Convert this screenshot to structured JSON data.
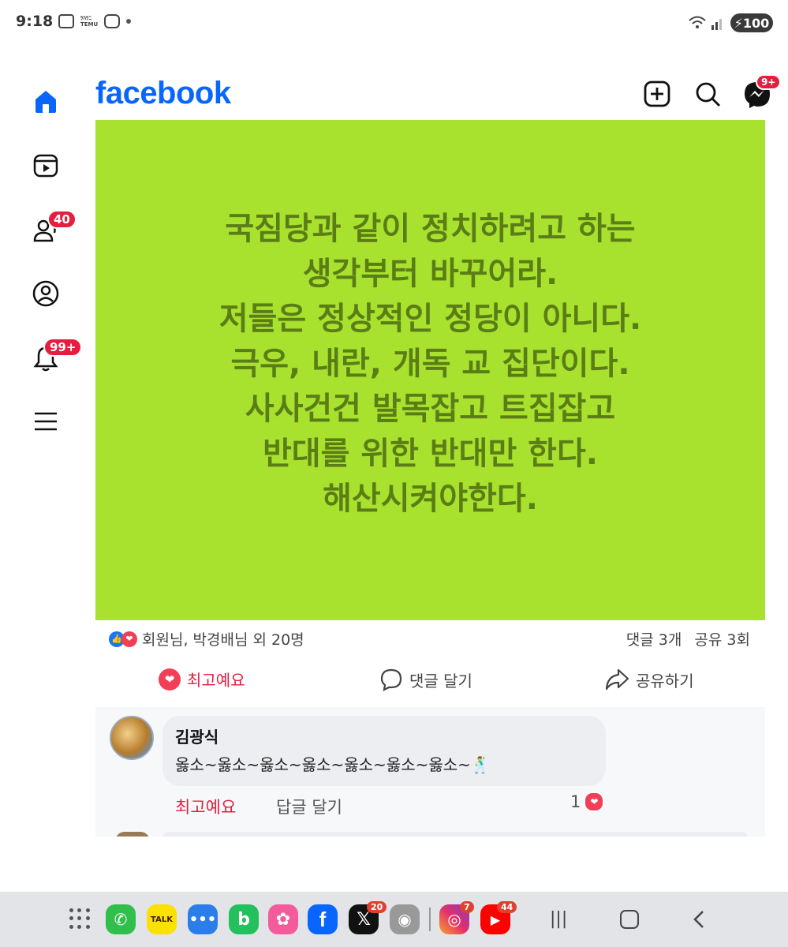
{
  "status_bar": {
    "time": "9:18",
    "temu": "TEMU",
    "battery": "100"
  },
  "left_nav": {
    "friends_badge": "40",
    "notifications_badge": "99+"
  },
  "header": {
    "logo": "facebook",
    "messenger_badge": "9+"
  },
  "post": {
    "image_text": "국짐당과 같이 정치하려고 하는\n생각부터 바꾸어라.\n저들은 정상적인 정당이 아니다.\n극우, 내란, 개독 교 집단이다.\n사사건건 발목잡고 트집잡고\n반대를 위한 반대만 한다.\n해산시켜야한다.",
    "reactions_text": "회원님, 박경배님 외 20명",
    "comments_count": "댓글 3개",
    "shares_count": "공유 3회",
    "like_label": "최고예요",
    "comment_label": "댓글 달기",
    "share_label": "공유하기"
  },
  "comment": {
    "author": "김광식",
    "text": "옳소~옳소~옳소~옳소~옳소~옳소~옳소~🕺",
    "like_label": "최고예요",
    "reply_label": "답글 달기",
    "reaction_count": "1"
  },
  "dock": {
    "kakao_label": "TALK",
    "x_badge": "20",
    "instagram_badge": "7",
    "youtube_badge": "44"
  },
  "colors": {
    "facebook_blue": "#0866ff",
    "post_bg": "#a8e22e",
    "post_text": "#5b7d16",
    "badge_red": "#e41e3f"
  }
}
